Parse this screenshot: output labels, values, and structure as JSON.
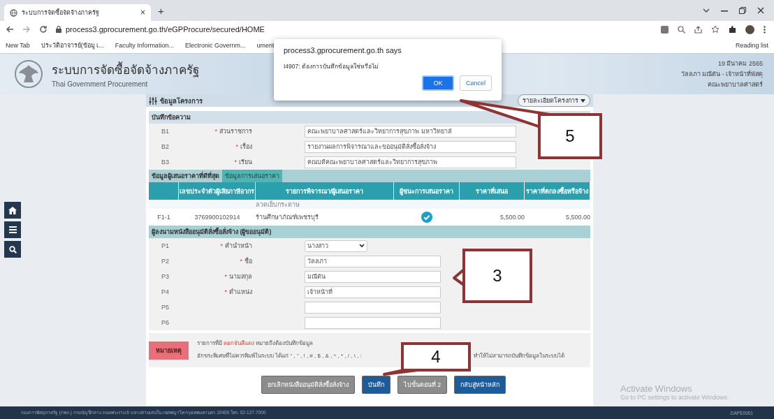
{
  "browser": {
    "tabs": [
      {
        "title": "ระบบการจัดซื้อจัดจ้างภาครัฐ",
        "close": "×",
        "selected": true
      }
    ],
    "new_tab": "+",
    "url": "process3.gprocurement.go.th/eGPProcure/secured/HOME",
    "bookmarks": [
      {
        "label": "New Tab"
      },
      {
        "label": "ประวัติอาจารย์(ข้อมู เ..."
      },
      {
        "label": "Faculty Information..."
      },
      {
        "label": "Electronic Governm..."
      },
      {
        "label": "ument"
      }
    ],
    "reading_list": "Reading list"
  },
  "header": {
    "title": "ระบบการจัดซื้อจัดจ้างภาครัฐ",
    "subtitle": "Thai Government Procurement",
    "date": "19 มีนาคม 2565",
    "user": "วัลลภา มณีตัน - เจ้าหน้าที่พัสดุ",
    "unit": "คณะพยาบาลศาสตร์"
  },
  "dialog": {
    "origin": "process3.gprocurement.go.th says",
    "message": "I4907: ต้องการบันทึกข้อมูลใช่หรือไม่",
    "ok": "OK",
    "cancel": "Cancel"
  },
  "panel": {
    "title": "ข้อมูลโครงการ",
    "details_button": "รายละเอียดโครงการ",
    "memo": {
      "heading": "บันทึกข้อความ",
      "rows": [
        {
          "code": "B1",
          "label": "ส่วนราชการ",
          "mark": "*",
          "value": "คณะพยาบาลศาสตร์และวิทยาการสุขภาพ มหาวิทยาลั"
        },
        {
          "code": "B2",
          "label": "เรื่อง",
          "mark": "*",
          "value": "รายงานผลการพิจารณาและขออนุมัติสั่งซื้อสั่งจ้าง"
        },
        {
          "code": "B3",
          "label": "เรียน",
          "mark": "*",
          "value": "คณบดีคณะพยาบาลศาสตร์และวิทยาการสุขภาพ"
        }
      ]
    },
    "bids": {
      "heading": "ข้อมูลผู้เสนอราคาที่ดีที่สุด",
      "tab": {
        "label": "ข้อมูลการเสนอราคา",
        "selected": true
      },
      "columns": [
        "เลขประจำตัวผู้เสียภาษีอากร",
        "รายการพิจารณา/ผู้เสนอราคา",
        "ผู้ชนะการเสนอราคา",
        "ราคาที่เสนอ",
        "ราคาที่ตกลงซื้อหรือจ้าง"
      ],
      "item": "ลวดเย็บกระดาษ",
      "rows": [
        {
          "code": "F1-1",
          "tax_id": "3769900102914",
          "bidder": "ร้านศึกษาภัณฑ์เพชรบุรี",
          "winner": true,
          "offer": "5,500.00",
          "agreed": "5,500.00"
        }
      ]
    },
    "signer": {
      "heading": "ผู้ลงนามหนังสืออนุมัติสั่งซื้อสั่งจ้าง (ผู้ขออนุมัติ)",
      "rows": [
        {
          "code": "P1",
          "label": "คำนำหน้า",
          "mark": "*",
          "kind": "select",
          "value": "นางสาว"
        },
        {
          "code": "P2",
          "label": "ชื่อ",
          "mark": "*",
          "kind": "text",
          "value": "วัลลภา"
        },
        {
          "code": "P3",
          "label": "นามสกุล",
          "mark": "*",
          "kind": "text",
          "value": "มณีตัน"
        },
        {
          "code": "P4",
          "label": "ตำแหน่ง",
          "mark": "*",
          "kind": "text",
          "value": "เจ้าหน้าที่"
        },
        {
          "code": "P5",
          "kind": "text"
        },
        {
          "code": "P6",
          "kind": "text"
        }
      ]
    },
    "remark": {
      "badge": "หมายเหตุ",
      "line1": [
        {
          "text": "รายการที่มี ",
          "kind": "plain"
        },
        {
          "text": "ดอกจันสีแดง",
          "kind": "red"
        },
        {
          "text": " หมายถึงต้องบันทึกข้อมูล",
          "kind": "plain"
        }
      ],
      "line2_start": "อักขระพิเศษที่ไม่ควรพิมพ์ในระบบ ได้แก่ \" , \" , ! , # , $ , & , ^ , * , / , \\ , :",
      "line2_end": "ทำให้ไม่สามารถบันทึกข้อมูลในระบบได้"
    },
    "buttons": [
      {
        "label": "ยกเลิกหนังสืออนุมัติสั่งซื้อสั่งจ้าง",
        "kind": "secondary"
      },
      {
        "label": "บันทึก",
        "kind": "primary"
      },
      {
        "label": "ไปขั้นตอนที่ 2",
        "kind": "secondary"
      },
      {
        "label": "กลับสู่หน้าหลัก",
        "kind": "primary"
      }
    ]
  },
  "callouts": [
    {
      "label": "5"
    },
    {
      "label": "3"
    },
    {
      "label": "4"
    }
  ],
  "footer": {
    "address": "กองการพัสดุภาครัฐ (กพภ.) กรมบัญชีกลาง ถนนพระราม 6 แขวงสามเสนใน เขตพญาไท กรุงเทพมหานคร 10400 โทร. 02-127-7000",
    "code": "DAPE0001"
  },
  "os_notice": {
    "title": "Activate Windows",
    "subtitle": "Go to PC settings to activate Windows."
  }
}
